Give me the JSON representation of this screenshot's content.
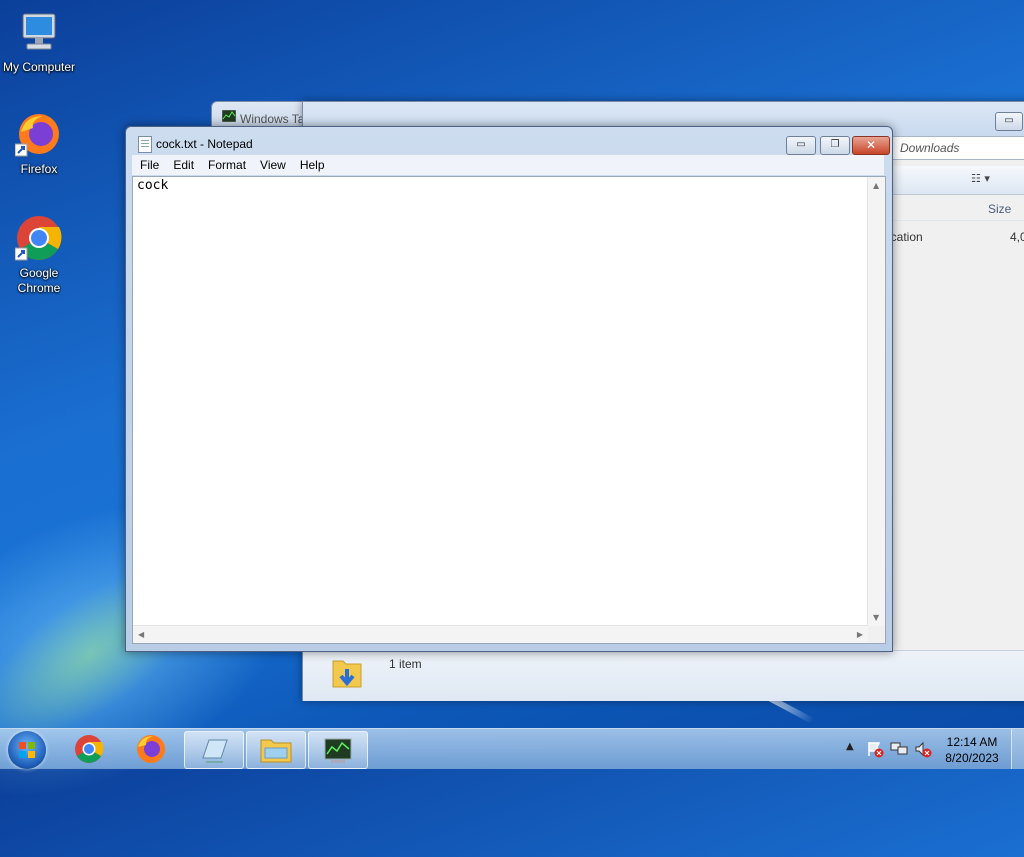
{
  "desktop": {
    "icons": [
      {
        "label": "My Computer"
      },
      {
        "label": "Firefox"
      },
      {
        "label": "Google Chrome"
      }
    ]
  },
  "explorer": {
    "taskmgr_tab_title": "Windows Ta",
    "address_text": "Downloads",
    "column_size": "Size",
    "row_type_fragment": "ication",
    "row_size_fragment": "4,0",
    "status_count": "1 item"
  },
  "notepad": {
    "title": "cock.txt - Notepad",
    "menu": [
      "File",
      "Edit",
      "Format",
      "View",
      "Help"
    ],
    "content": "cock",
    "buttons": {
      "minimize": "▭",
      "maximize": "❐",
      "close": "✕"
    }
  },
  "taskbar": {
    "time": "12:14 AM",
    "date": "8/20/2023",
    "pinned": [
      "chrome-icon",
      "firefox-icon",
      "notepad-icon",
      "explorer-icon",
      "taskmgr-icon"
    ]
  },
  "colors": {
    "desktop_blue": "#1a6fd1",
    "close_red": "#c7442a"
  }
}
